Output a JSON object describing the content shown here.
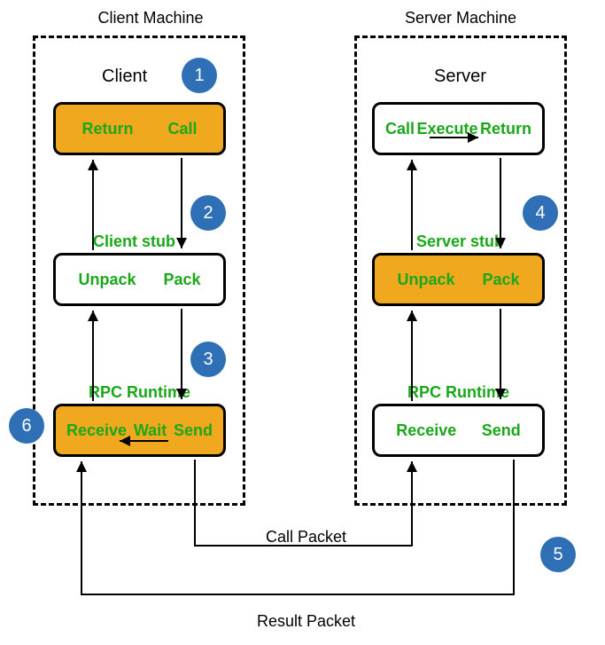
{
  "titles": {
    "client_machine": "Client Machine",
    "server_machine": "Server Machine"
  },
  "headers": {
    "client": "Client",
    "server": "Server"
  },
  "client": {
    "box1_left": "Return",
    "box1_right": "Call",
    "stub": "Client stub",
    "box2_left": "Unpack",
    "box2_right": "Pack",
    "runtime": "RPC Runtime",
    "box3_left": "Receive",
    "box3_mid": "Wait",
    "box3_right": "Send"
  },
  "server": {
    "box1_left": "Call",
    "box1_mid": "Execute",
    "box1_right": "Return",
    "stub": "Server stub",
    "box2_left": "Unpack",
    "box2_right": "Pack",
    "runtime": "RPC Runtime",
    "box3_left": "Receive",
    "box3_right": "Send"
  },
  "steps": {
    "s1": "1",
    "s2": "2",
    "s3": "3",
    "s4": "4",
    "s5": "5",
    "s6": "6"
  },
  "packets": {
    "call": "Call Packet",
    "result": "Result Packet"
  }
}
